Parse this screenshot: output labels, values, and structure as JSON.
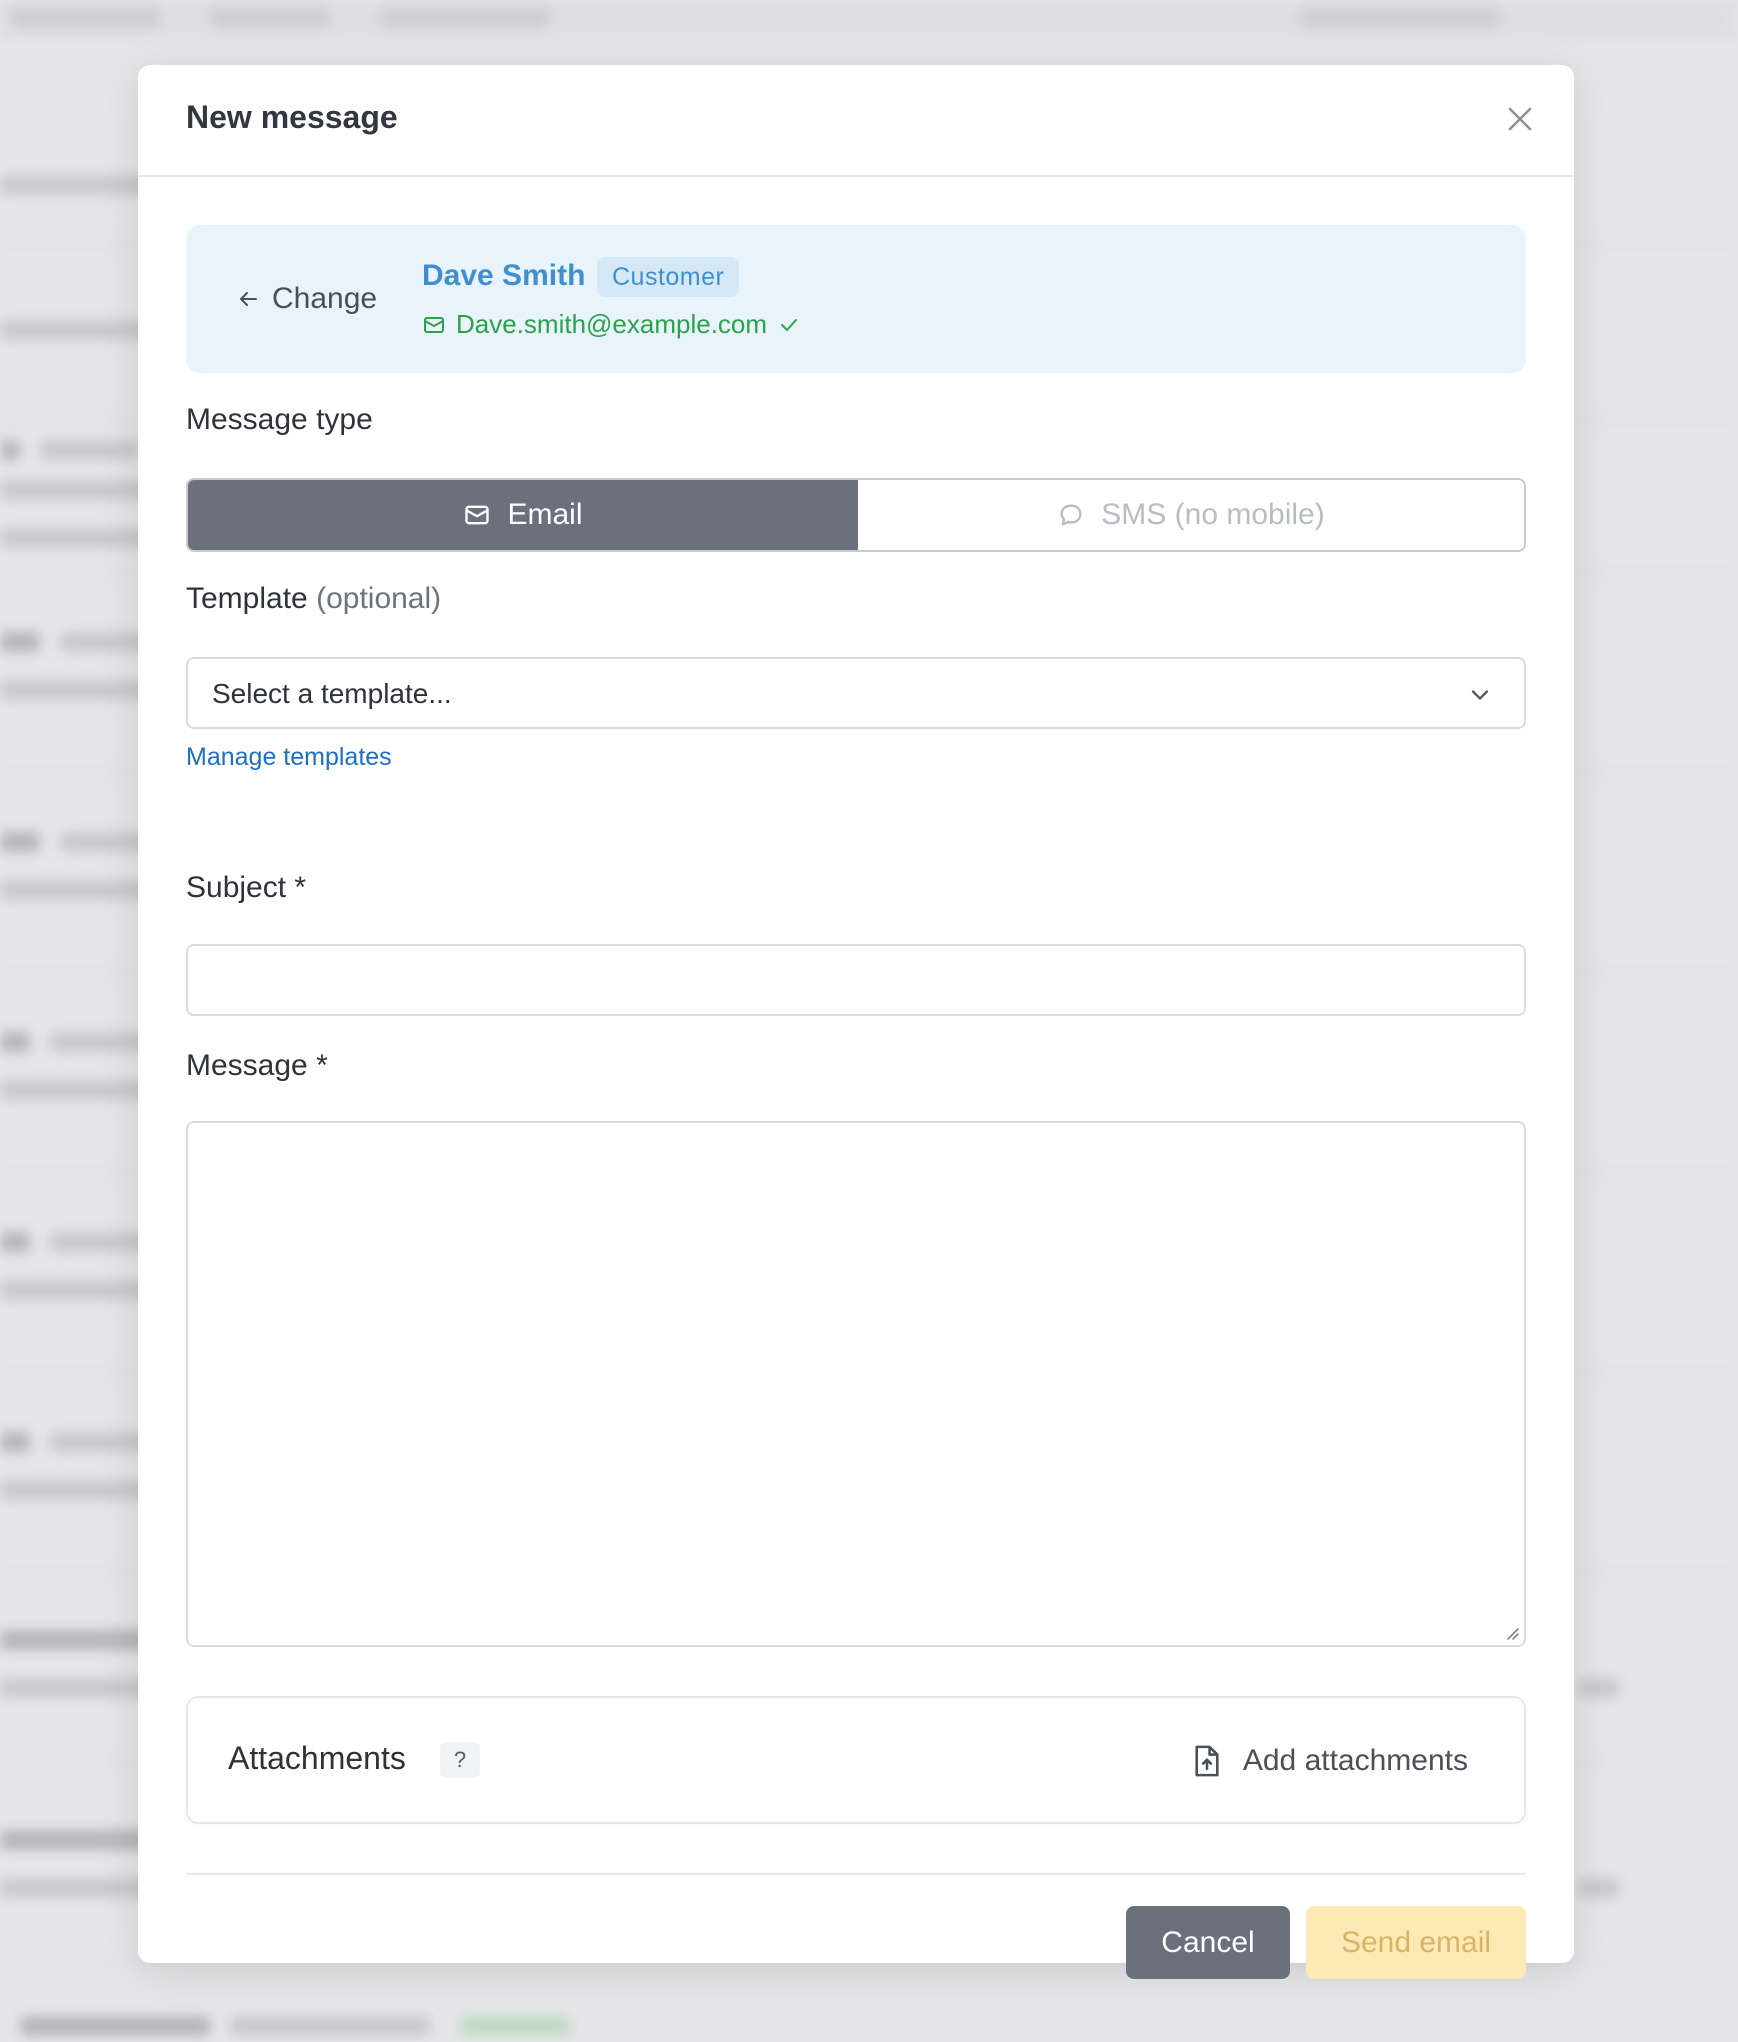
{
  "modal": {
    "title": "New message"
  },
  "recipient": {
    "change_label": "Change",
    "name": "Dave Smith",
    "badge": "Customer",
    "email": "Dave.smith@example.com"
  },
  "message_type": {
    "label": "Message type",
    "options": [
      {
        "label": "Email",
        "selected": true
      },
      {
        "label": "SMS (no mobile)",
        "selected": false
      }
    ]
  },
  "template": {
    "label": "Template",
    "label_hint": "(optional)",
    "placeholder": "Select a template...",
    "manage_link": "Manage templates"
  },
  "subject": {
    "label": "Subject *",
    "value": ""
  },
  "message": {
    "label": "Message *",
    "value": ""
  },
  "attachments": {
    "title": "Attachments",
    "help": "?",
    "add_label": "Add attachments"
  },
  "footer": {
    "cancel_label": "Cancel",
    "send_label": "Send email"
  },
  "colors": {
    "primary_button": "#6b707d",
    "send_button_disabled": "#fde9b6",
    "recipient_bg": "#e8f3fb",
    "recipient_name": "#3f8fd0",
    "verified_green": "#2aa34a",
    "link": "#1d6fc4"
  },
  "icons": {
    "close": "close-icon",
    "back": "arrow-left-icon",
    "email": "mail-icon",
    "verified": "check-icon",
    "sms": "chat-bubble-icon",
    "dropdown": "chevron-down-icon",
    "upload": "file-upload-icon"
  }
}
